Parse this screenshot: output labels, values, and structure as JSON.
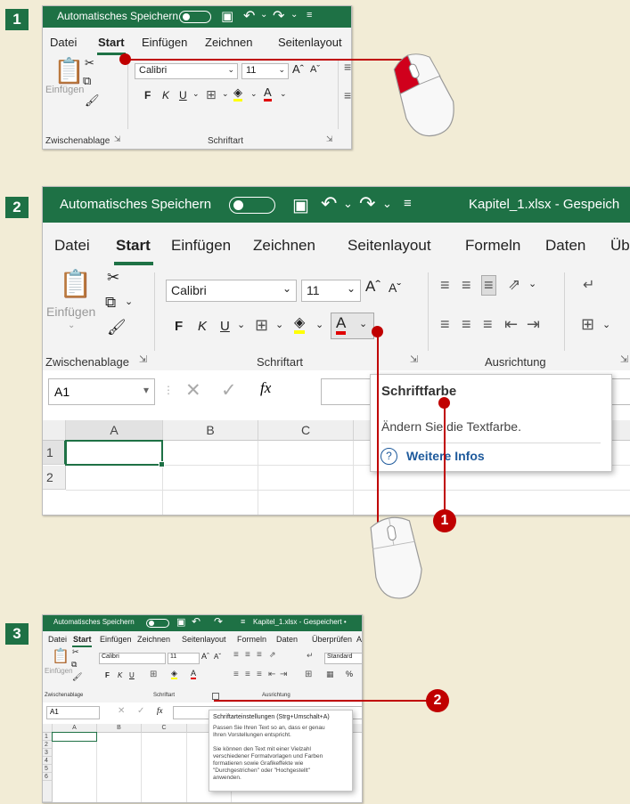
{
  "steps": [
    "1",
    "2",
    "3"
  ],
  "callouts": [
    "1",
    "2"
  ],
  "excel": {
    "autosave": "Automatisches Speichern",
    "filename": "Kapitel_1.xlsx - Gespeich",
    "filename_full": "Kapitel_1.xlsx - Gespeichert •",
    "tabs": [
      "Datei",
      "Start",
      "Einfügen",
      "Zeichnen",
      "Seitenlayout",
      "Formeln",
      "Daten",
      "Üb"
    ],
    "tabs_small": [
      "Datei",
      "Start",
      "Einfügen",
      "Zeichnen",
      "Seitenlayout",
      "Formeln",
      "Daten",
      "Überprüfen",
      "A"
    ],
    "paste": "Einfügen",
    "font_name": "Calibri",
    "font_size": "11",
    "bold": "F",
    "italic": "K",
    "underline": "U",
    "groups": {
      "clipboard": "Zwischenablage",
      "font": "Schriftart",
      "alignment": "Ausrichtung"
    },
    "number_format": "Standard",
    "percent": "%",
    "name_box": "A1",
    "fx": "fx",
    "columns": [
      "A",
      "B",
      "C",
      "D"
    ],
    "rows": [
      "1",
      "2",
      "3",
      "4",
      "5",
      "6"
    ],
    "colors": {
      "excel_green": "#1e7145",
      "highlight_yellow": "#ffff00",
      "font_red": "#e00000",
      "callout_red": "#c00000"
    }
  },
  "tooltip_font_color": {
    "title": "Schriftfarbe",
    "description": "Ändern Sie die Textfarbe.",
    "link": "Weitere Infos",
    "link_icon": "help-circle-icon"
  },
  "tooltip_font_settings": {
    "title": "Schriftarteinstellungen (Strg+Umschalt+A)",
    "line1": "Passen Sie Ihren Text so an, dass er genau",
    "line2": "Ihren Vorstellungen entspricht.",
    "line3": "Sie können den Text mit einer Vielzahl",
    "line4": "verschiedener Formatvorlagen und Farben",
    "line5": "formatieren sowie Grafikeffekte wie",
    "line6": "\"Durchgestrichen\" oder \"Hochgestellt\"",
    "line7": "anwenden."
  }
}
